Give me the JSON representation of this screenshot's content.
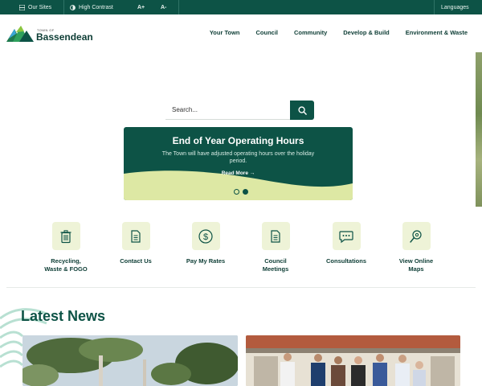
{
  "utility": {
    "our_sites": "Our Sites",
    "high_contrast": "High Contrast",
    "font_increase": "A+",
    "font_decrease": "A-",
    "languages": "Languages"
  },
  "logo": {
    "small_text": "TOWN OF",
    "name": "Bassendean"
  },
  "nav": {
    "items": [
      "Your Town",
      "Council",
      "Community",
      "Develop & Build",
      "Environment & Waste"
    ]
  },
  "search": {
    "placeholder": "Search..."
  },
  "banner": {
    "title": "End of Year Operating Hours",
    "text": "The Town will have adjusted operating hours over the holiday period.",
    "link": "Read More →",
    "slide_count": 2,
    "active_slide": 2
  },
  "quick_links": [
    {
      "label_1": "Recycling,",
      "label_2": "Waste & FOGO",
      "icon": "trash-icon"
    },
    {
      "label_1": "Contact Us",
      "label_2": "",
      "icon": "document-icon"
    },
    {
      "label_1": "Pay My Rates",
      "label_2": "",
      "icon": "dollar-icon"
    },
    {
      "label_1": "Council",
      "label_2": "Meetings",
      "icon": "document-icon"
    },
    {
      "label_1": "Consultations",
      "label_2": "",
      "icon": "chat-icon"
    },
    {
      "label_1": "View Online",
      "label_2": "Maps",
      "icon": "map-pin-icon"
    }
  ],
  "news": {
    "title": "Latest News"
  },
  "colors": {
    "primary": "#0d5346",
    "accent": "#d9e79a",
    "icon_bg": "#eef3d7"
  }
}
